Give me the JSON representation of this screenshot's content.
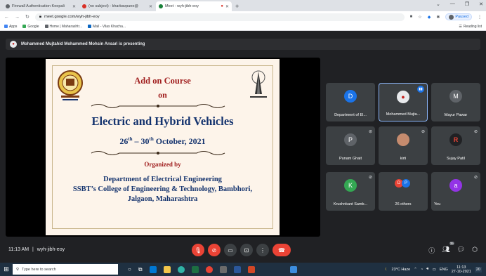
{
  "browser": {
    "tabs": [
      {
        "label": "Firewall Authentication Keepali",
        "color": "#5f6368",
        "active": false
      },
      {
        "label": "(no subject) - kharbavpune@",
        "color": "#d93025",
        "active": false
      },
      {
        "label": "Meet - wyh-jibh-eoy",
        "color": "#188038",
        "active": true
      }
    ],
    "new_tab": "+",
    "url": "meet.google.com/wyh-jibh-eoy",
    "paused_label": "Paused",
    "bookmarks": [
      {
        "label": "Apps",
        "color": "#4285f4"
      },
      {
        "label": "Google",
        "color": "#34a853"
      },
      {
        "label": "Home | Maharashtr...",
        "color": "#5f6368"
      },
      {
        "label": "Mail - Vilas Khacha...",
        "color": "#0a66c2"
      }
    ],
    "reading_list": "Reading list"
  },
  "meet": {
    "presenting_banner": "Mohammed Mujtahid Mohammed Mohsin Ansari is presenting",
    "slide": {
      "line1": "Add on Course",
      "line2": "on",
      "title": "Electric and Hybrid Vehicles",
      "date_start": "26",
      "date_start_sup": "th",
      "date_sep": " – 30",
      "date_end_sup": "th",
      "date_rest": "  October, 2021",
      "organized_by": "Organized by",
      "dept": "Department of Electrical Engineering",
      "college": "SSBT’s College of Engineering & Technology, Bambhori,",
      "city": "Jalgaon, Maharashtra"
    },
    "participants": [
      {
        "name": "Department of El...",
        "initial": "D",
        "color": "#1a73e8"
      },
      {
        "name": "Mohammed Mujta...",
        "initial": "",
        "color": "#e8eaed"
      },
      {
        "name": "Mayur Pawar",
        "initial": "M",
        "color": "#5f6368"
      },
      {
        "name": "Punam Ghait",
        "initial": "P",
        "color": "#5f6368"
      },
      {
        "name": "kirti",
        "initial": "",
        "color": "#c58b6e"
      },
      {
        "name": "Sujay Patil",
        "initial": "R",
        "color": "#202124"
      },
      {
        "name": "Krushnkant Samb...",
        "initial": "K",
        "color": "#34a853"
      },
      {
        "name": "26 others",
        "initial": "",
        "color": "#3c4043"
      },
      {
        "name": "You",
        "initial": "a",
        "color": "#9334e6"
      }
    ],
    "others_badges": [
      "D",
      "P"
    ],
    "time": "11:13 AM",
    "separator": "|",
    "meeting_code": "wyh-jibh-eoy",
    "people_count": "35"
  },
  "taskbar": {
    "search_placeholder": "Type here to search",
    "weather": "23°C  Haze",
    "lang": "ENG",
    "time": "11:13",
    "date": "27-10-2021",
    "notif": "20"
  }
}
